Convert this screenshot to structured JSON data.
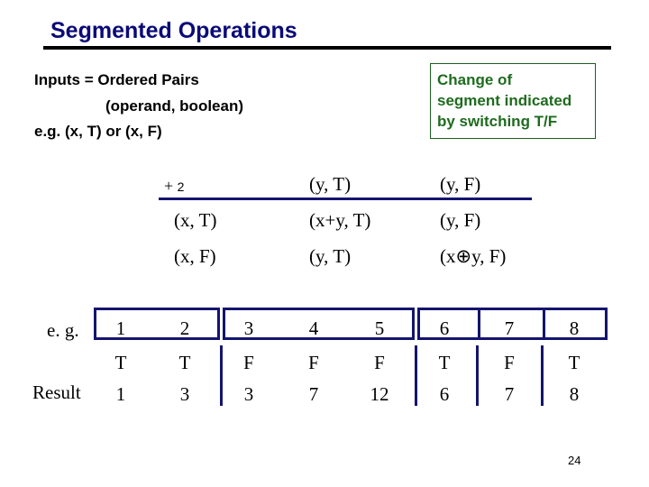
{
  "title": "Segmented Operations",
  "intro": {
    "line1": "Inputs = Ordered Pairs",
    "line2": "(operand, boolean)",
    "line3": "e.g. (x, T) or (x, F)"
  },
  "note": {
    "line1": "Change of",
    "line2": "segment indicated",
    "line3": "by switching T/F",
    "color": "#1e6b1e"
  },
  "op_table": {
    "operator": "+",
    "operator_sub": "2",
    "col_headers": [
      "(y, T)",
      "(y, F)"
    ],
    "rows": [
      {
        "header": "(x, T)",
        "cells": [
          "(x+y, T)",
          "(y, F)"
        ]
      },
      {
        "header": "(x, F)",
        "cells": [
          "(y, T)",
          "(x⊕y, F)"
        ]
      }
    ]
  },
  "example": {
    "label": "e. g.",
    "result_label": "Result",
    "values": [
      "1",
      "2",
      "3",
      "4",
      "5",
      "6",
      "7",
      "8"
    ],
    "flags": [
      "T",
      "T",
      "F",
      "F",
      "F",
      "T",
      "F",
      "T"
    ],
    "results": [
      "1",
      "3",
      "3",
      "7",
      "12",
      "6",
      "7",
      "8"
    ]
  },
  "page_number": "24"
}
